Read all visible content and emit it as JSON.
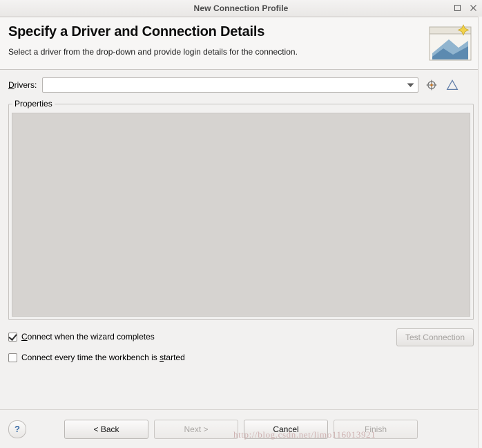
{
  "window": {
    "title": "New Connection Profile",
    "buttons": {
      "maximize": "maximize-icon",
      "close": "close-icon"
    }
  },
  "header": {
    "title": "Specify a Driver and Connection Details",
    "subtitle": "Select a driver from the drop-down and provide login details for the connection.",
    "icon": "database-wizard-icon"
  },
  "form": {
    "drivers_label": "Drivers:",
    "drivers_label_mnemonic": "D",
    "drivers_value": "",
    "drivers_placeholder": "",
    "dropdown_icon": "chevron-down-icon",
    "new_driver_icon": "new-driver-definition-icon",
    "edit_driver_icon": "driver-warning-icon"
  },
  "properties": {
    "group_title": "Properties",
    "content": ""
  },
  "options": [
    {
      "label": "Connect when the wizard completes",
      "mnemonic": "C",
      "checked": true
    },
    {
      "label": "Connect every time the workbench is started",
      "mnemonic": "s",
      "checked": false
    }
  ],
  "test_connection": {
    "label": "Test Connection",
    "enabled": false
  },
  "footer": {
    "help_label": "?",
    "buttons": [
      {
        "label": "< Back",
        "enabled": true,
        "name": "back-button"
      },
      {
        "label": "Next >",
        "enabled": false,
        "name": "next-button"
      },
      {
        "label": "Cancel",
        "enabled": true,
        "name": "cancel-button"
      },
      {
        "label": "Finish",
        "enabled": false,
        "name": "finish-button"
      }
    ]
  },
  "watermark": "http://blog.csdn.net/limo116013921"
}
